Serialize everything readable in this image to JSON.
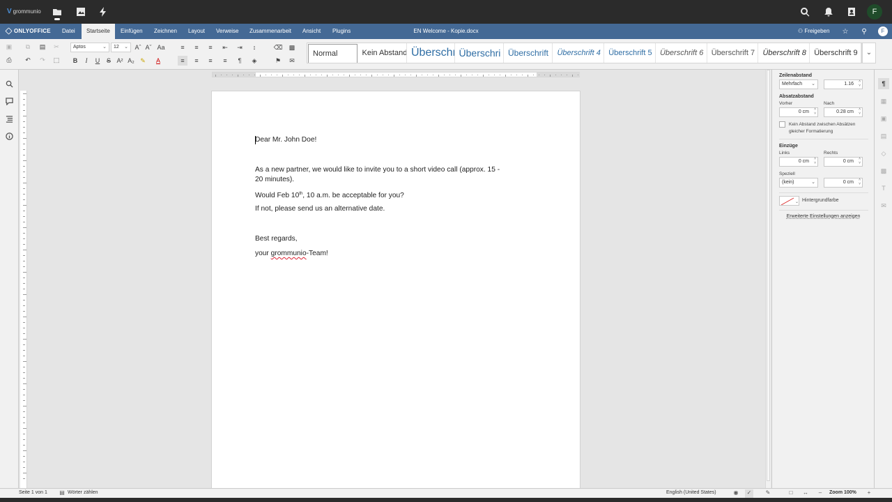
{
  "topbar": {
    "logo_text": "grommunio",
    "avatar_letter": "F",
    "icons": [
      "folder-icon",
      "image-icon",
      "bolt-icon",
      "search-icon",
      "bell-icon",
      "contacts-icon"
    ]
  },
  "menubar": {
    "brand": "ONLYOFFICE",
    "tabs": [
      "Datei",
      "Startseite",
      "Einfügen",
      "Zeichnen",
      "Layout",
      "Verweise",
      "Zusammenarbeit",
      "Ansicht",
      "Plugins"
    ],
    "active_tab": "Startseite",
    "document_title": "EN Welcome - Kopie.docx",
    "share_label": "Freigeben",
    "user_letter": "F"
  },
  "toolbar": {
    "font_name": "Aptos",
    "font_size": "12",
    "styles": [
      "Normal",
      "Kein Abstand",
      "Überschr",
      "Überschri",
      "Überschrift",
      "Überschrift 4",
      "Überschrift 5",
      "Überschrift 6",
      "Überschrift 7",
      "Überschrift 8",
      "Überschrift 9"
    ]
  },
  "document": {
    "greeting": "Dear Mr. John Doe!",
    "para1_line1": "As a new partner, we would like to invite you to a short video call (approx. 15 -",
    "para1_line2": "20 minutes).",
    "line3_pre": "Would Feb 10",
    "line3_sup": "th",
    "line3_post": ", 10 a.m. be acceptable for you?",
    "line4": "If not, please send us an alternative date.",
    "closing": "Best regards,",
    "sign_pre": "your ",
    "sign_misspelled": "grommunio",
    "sign_post": "-Team!"
  },
  "right_panel": {
    "line_spacing_heading": "Zeilenabstand",
    "line_spacing_mode": "Mehrfach",
    "line_spacing_value": "1.16",
    "paragraph_spacing_heading": "Absatzabstand",
    "before_label": "Vorher",
    "before_value": "0 cm",
    "after_label": "Nach",
    "after_value": "0.28 cm",
    "no_space_checkbox_line1": "Kein Abstand zwischen Absätzen",
    "no_space_checkbox_line2": "gleicher Formatierung",
    "indents_heading": "Einzüge",
    "left_label": "Links",
    "left_value": "0 cm",
    "right_label": "Rechts",
    "right_value": "0 cm",
    "special_label": "Speziell",
    "special_value": "(kein)",
    "special_amount": "0 cm",
    "background_label": "Hintergrundfarbe",
    "advanced_link": "Erweiterte Einstellungen anzeigen"
  },
  "statusbar": {
    "page_info": "Seite 1 von 1",
    "word_count": "Wörter zählen",
    "language": "English (United States)",
    "zoom": "Zoom 100%"
  }
}
